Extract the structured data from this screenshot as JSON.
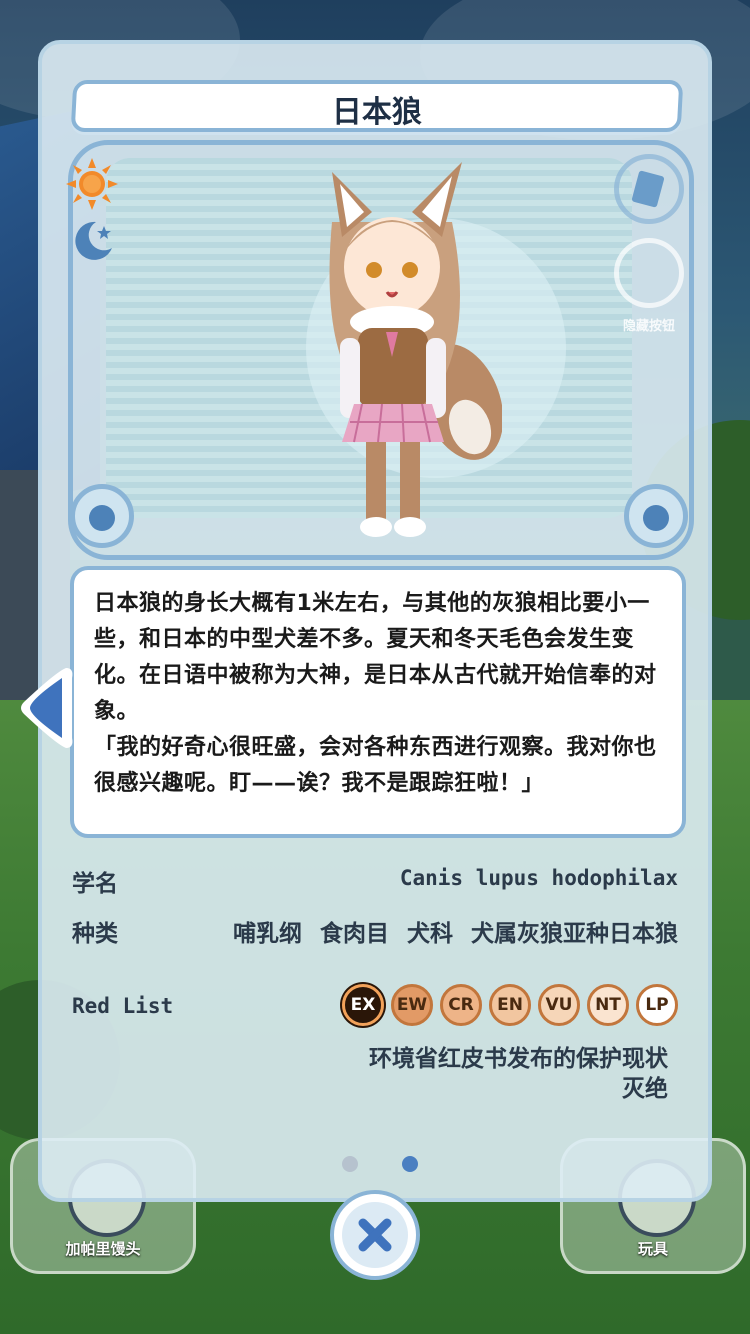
{
  "title": "日本狼",
  "description": [
    "日本狼的身长大概有1米左右，与其他的灰狼相比要小一些，和日本的中型犬差不多。夏天和冬天毛色会发生变化。在日语中被称为大神，是日本从古代就开始信奉的对象。",
    "「我的好奇心很旺盛，会对各种东西进行观察。我对你也很感兴趣呢。盯——诶？我不是跟踪狂啦！」"
  ],
  "scientific_name_label": "学名",
  "scientific_name": "Canis lupus hodophilax",
  "classification_label": "种类",
  "classification": "哺乳纲 食肉目 犬科 犬属灰狼亚种日本狼",
  "red_list_label": "Red List",
  "red_list": [
    {
      "code": "EX",
      "fill": "#2a1608",
      "text": "#ffffff",
      "active": true
    },
    {
      "code": "EW",
      "fill": "#e29a66",
      "text": "#4a2a10"
    },
    {
      "code": "CR",
      "fill": "#eeb488",
      "text": "#4a2a10"
    },
    {
      "code": "EN",
      "fill": "#f2c6a0",
      "text": "#4a2a10"
    },
    {
      "code": "VU",
      "fill": "#f6d6b8",
      "text": "#4a2a10"
    },
    {
      "code": "NT",
      "fill": "#fae4d0",
      "text": "#4a2a10"
    },
    {
      "code": "LP",
      "fill": "#ffffff",
      "text": "#4a2a10"
    }
  ],
  "status_caption": "环境省红皮书发布的保护现状",
  "status_value": "灭绝",
  "page_indicator": {
    "total": 2,
    "current": 2
  },
  "bottom_left_label": "加帕里馒头",
  "bottom_right_label": "玩具",
  "side_hint_label": "隐藏按钮",
  "icons": [
    "sun-icon",
    "moon-icon",
    "prev-arrow-icon",
    "close-icon"
  ],
  "colors": {
    "frame": "#8ab4d6",
    "accent": "#4a7fc1",
    "sun": "#f28a2a"
  }
}
